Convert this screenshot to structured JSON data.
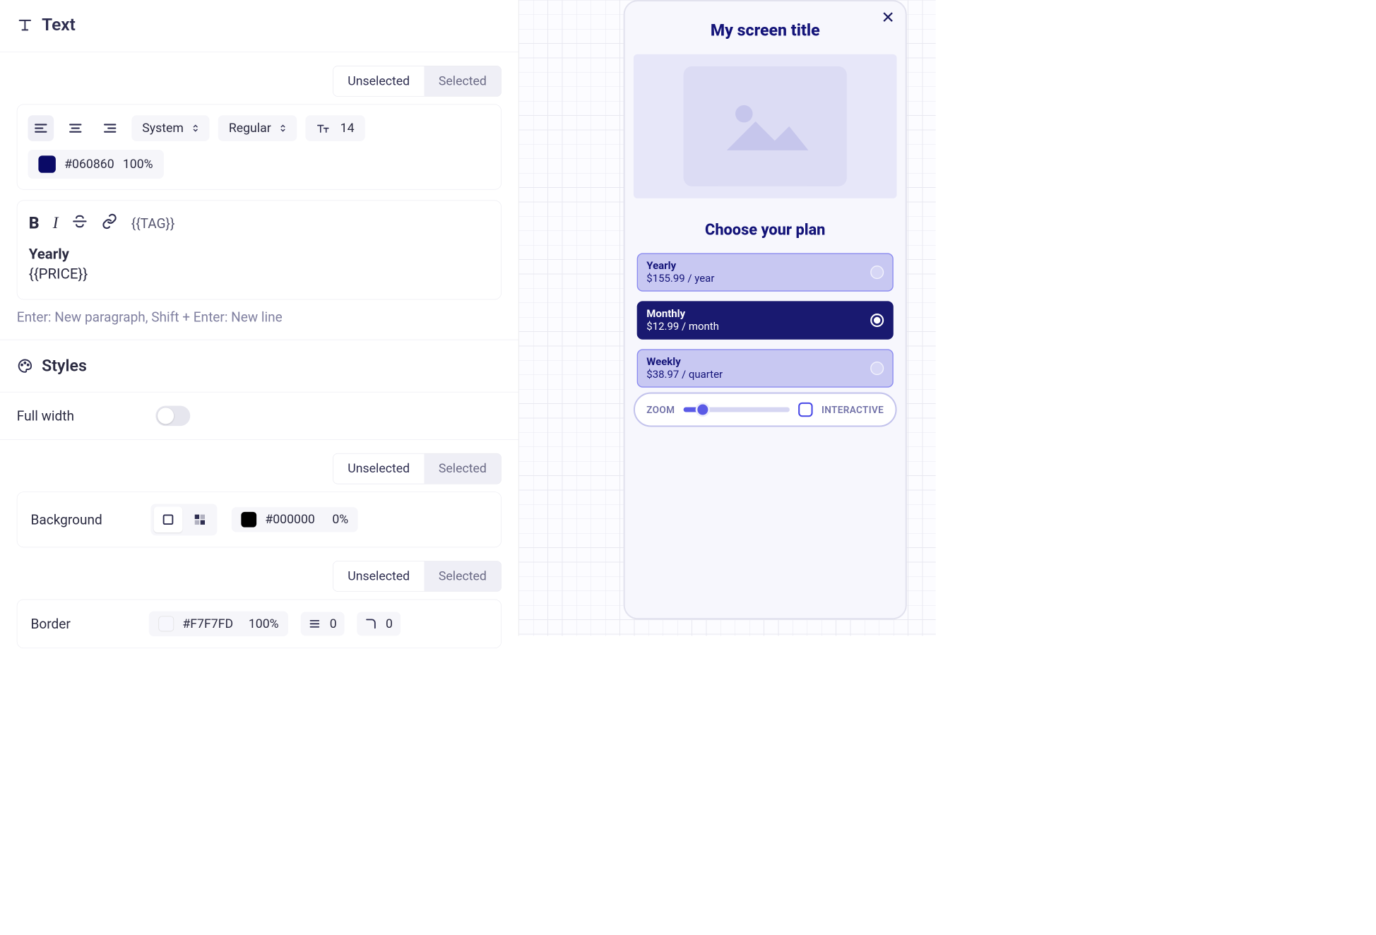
{
  "editor": {
    "section_title": "Text",
    "state_tabs": {
      "unselected": "Unselected",
      "selected": "Selected"
    },
    "font_family": "System",
    "font_weight": "Regular",
    "font_size": "14",
    "text_color_hex": "#060860",
    "text_color_opacity": "100%",
    "tag_button": "{{TAG}}",
    "content_line1": "Yearly",
    "content_line2": "{{PRICE}}",
    "hint": "Enter: New paragraph, Shift + Enter: New line",
    "styles_title": "Styles",
    "full_width_label": "Full width",
    "full_width_value": false,
    "background_label": "Background",
    "background_hex": "#000000",
    "background_opacity": "0%",
    "border_label": "Border",
    "border_hex": "#F7F7FD",
    "border_opacity": "100%",
    "border_width": "0",
    "border_radius": "0"
  },
  "preview": {
    "screen_title": "My screen title",
    "section_title": "Choose your plan",
    "plans": [
      {
        "name": "Yearly",
        "price": "$155.99 / year",
        "selected": false
      },
      {
        "name": "Monthly",
        "price": "$12.99 / month",
        "selected": true
      },
      {
        "name": "Weekly",
        "price": "$38.97 / quarter",
        "selected": false
      }
    ],
    "footer": {
      "zoom_label": "ZOOM",
      "interactive_label": "INTERACTIVE"
    }
  }
}
